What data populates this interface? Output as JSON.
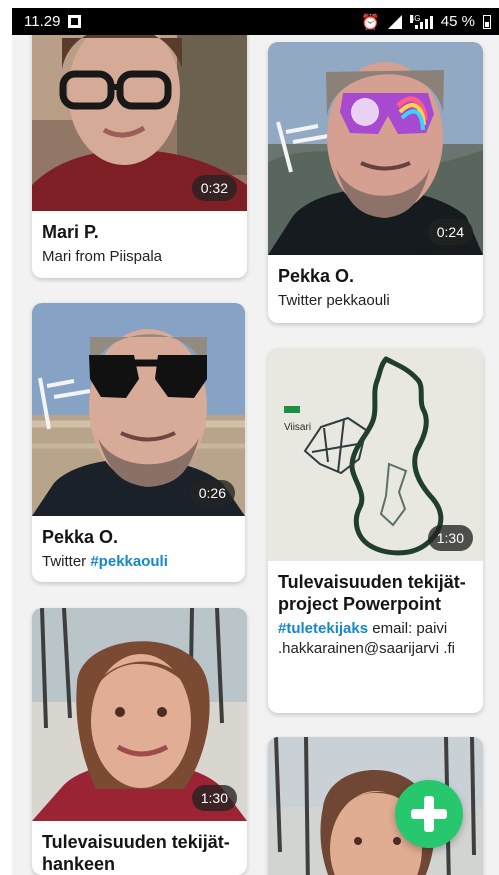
{
  "status_bar": {
    "time": "11.29",
    "network_badge": "4G",
    "battery_percent": "45 %"
  },
  "cards": [
    {
      "title": "Mari P.",
      "description": "Mari from Piispala",
      "duration": "0:32"
    },
    {
      "title": "Pekka O.",
      "description": "Twitter pekkaouli",
      "duration": "0:24"
    },
    {
      "title": "Pekka O.",
      "description_prefix": "Twitter ",
      "hashtag": "#pekkaouli",
      "duration": "0:26"
    },
    {
      "title": "Tulevaisuuden tekijät-project Powerpoint",
      "hashtag": "#tuletekijaks",
      "description_suffix": " email: paivi .hakkarainen@saarijarvi .fi",
      "duration": "1:30",
      "map_label": "Viisari"
    },
    {
      "title": "Tulevaisuuden tekijät-hankeen",
      "duration": "1:30"
    }
  ],
  "icons": {
    "fab": "plus-icon",
    "alarm": "alarm-icon",
    "signal": "signal-icon",
    "battery": "battery-icon",
    "notification": "notification-icon"
  },
  "colors": {
    "accent": "#27c86d",
    "hashtag": "#1687c9",
    "page_background": "#f2f2f2"
  }
}
